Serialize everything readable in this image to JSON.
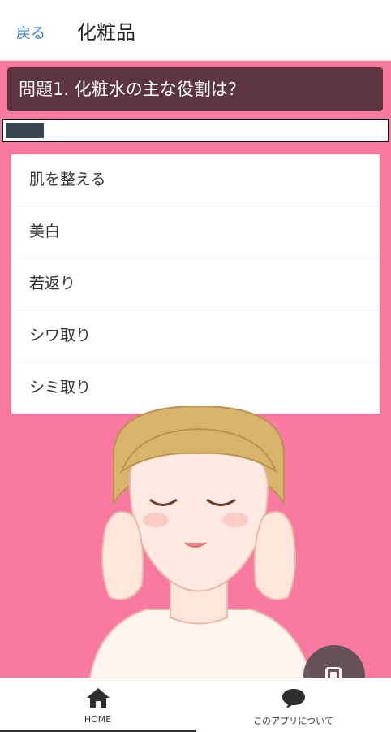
{
  "header": {
    "back_label": "戻る",
    "title": "化粧品"
  },
  "question": {
    "text": "問題1. 化粧水の主な役割は？"
  },
  "progress": {
    "fraction": 0.1
  },
  "answers": [
    {
      "label": "肌を整える"
    },
    {
      "label": "美白"
    },
    {
      "label": "若返り"
    },
    {
      "label": "シワ取り"
    },
    {
      "label": "シミ取り"
    }
  ],
  "bottom_nav": {
    "tabs": [
      {
        "label": "HOME",
        "icon": "home-icon",
        "active": true
      },
      {
        "label": "このアプリについて",
        "icon": "chat-bubble-icon",
        "active": false
      }
    ]
  },
  "fab": {
    "icon": "stop-square-icon"
  },
  "colors": {
    "background": "#f97aa1",
    "question_bar": "#5c3640",
    "progress_fill": "#38474f",
    "link_blue": "#3a7bd5"
  }
}
